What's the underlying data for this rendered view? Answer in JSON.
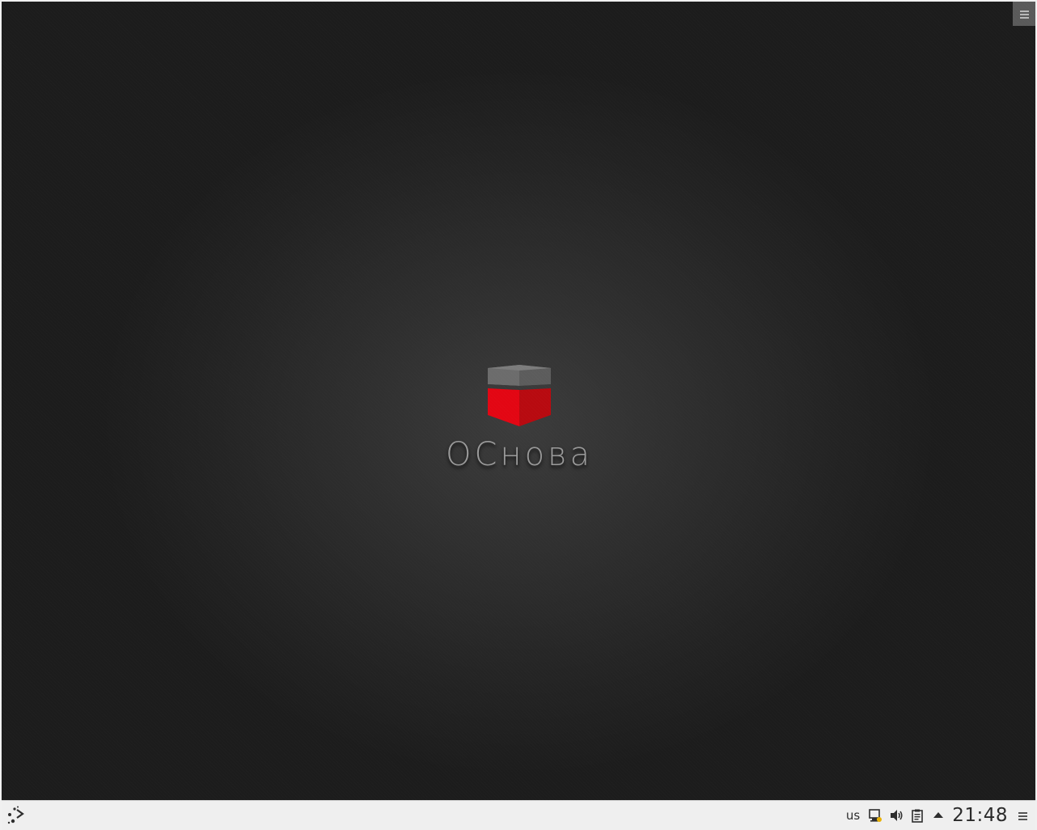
{
  "desktop": {
    "logo_text": "OCнова",
    "toolbox_icon": "hamburger-menu-icon"
  },
  "panel": {
    "launcher_icon": "application-launcher-icon",
    "keyboard_layout": "us",
    "tray_icons": [
      "network-icon",
      "volume-icon",
      "clipboard-icon",
      "expand-up-icon"
    ],
    "clock": "21:48",
    "menu_icon": "hamburger-menu-icon"
  },
  "colors": {
    "logo_red": "#e30613",
    "logo_gray": "#6a6a6a",
    "panel_bg": "#efefef"
  }
}
